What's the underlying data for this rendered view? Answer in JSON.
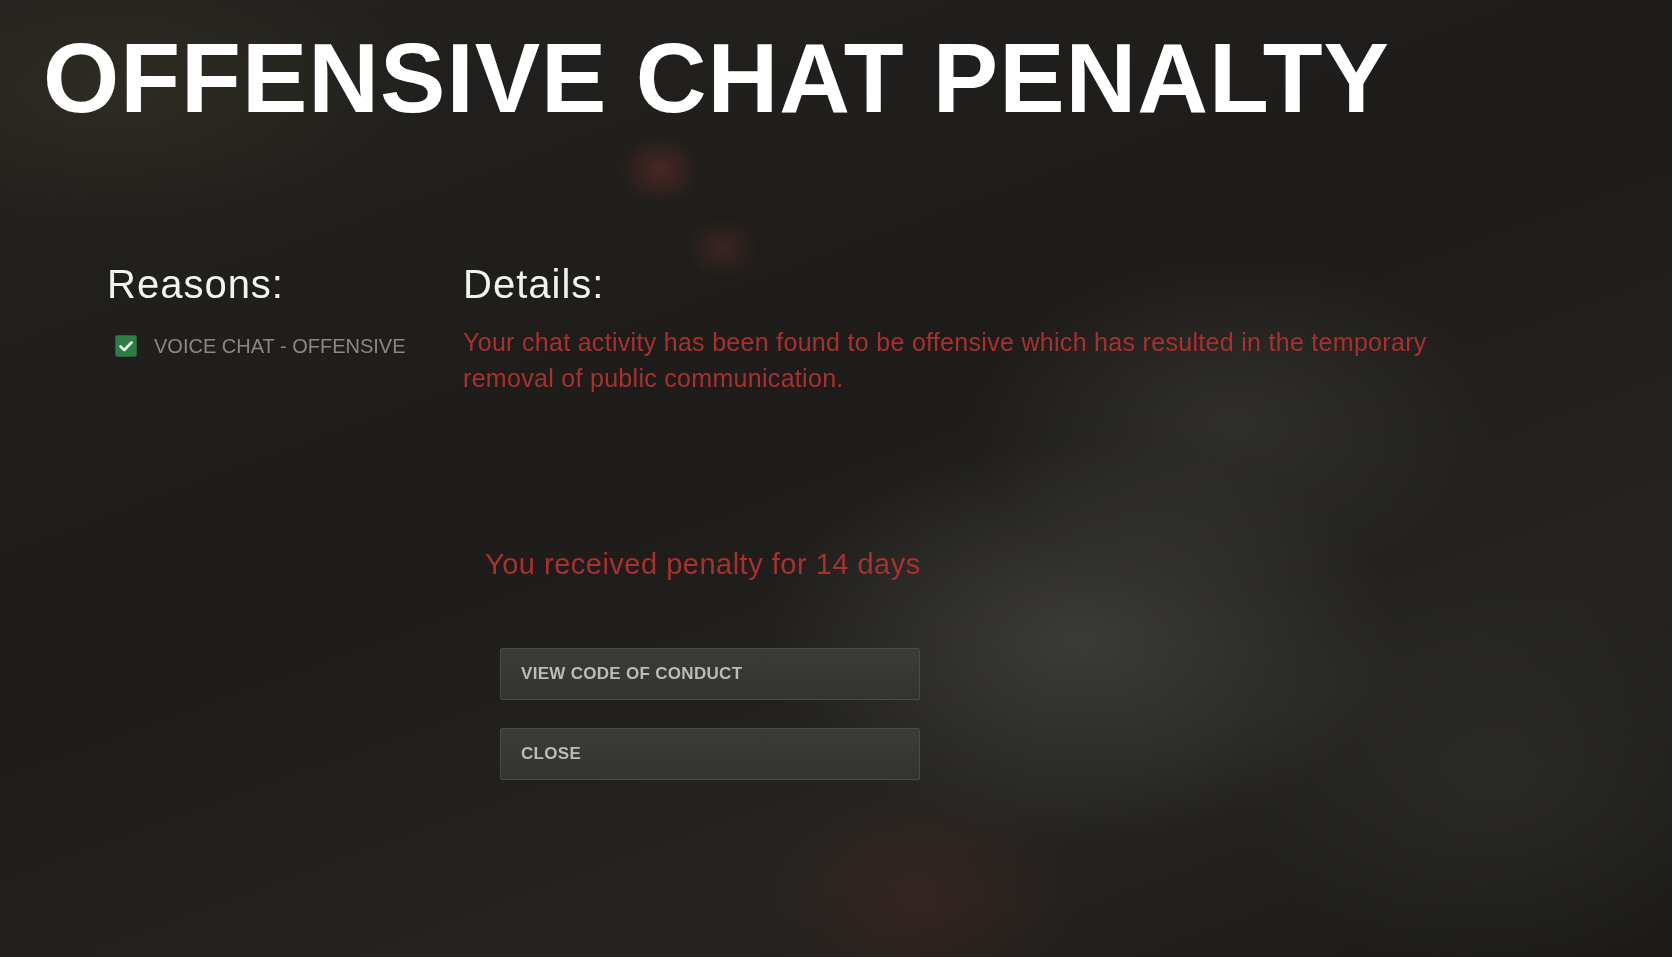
{
  "title": "OFFENSIVE CHAT PENALTY",
  "reasons": {
    "heading": "Reasons:",
    "items": [
      {
        "label": "VOICE CHAT - OFFENSIVE",
        "checked": true
      }
    ]
  },
  "details": {
    "heading": "Details:",
    "text": "Your chat activity has been found to be offensive which has resulted in the temporary removal of public communication."
  },
  "penalty_notice": "You received penalty for 14 days",
  "buttons": [
    {
      "label": "VIEW CODE OF CONDUCT"
    },
    {
      "label": "CLOSE"
    }
  ]
}
